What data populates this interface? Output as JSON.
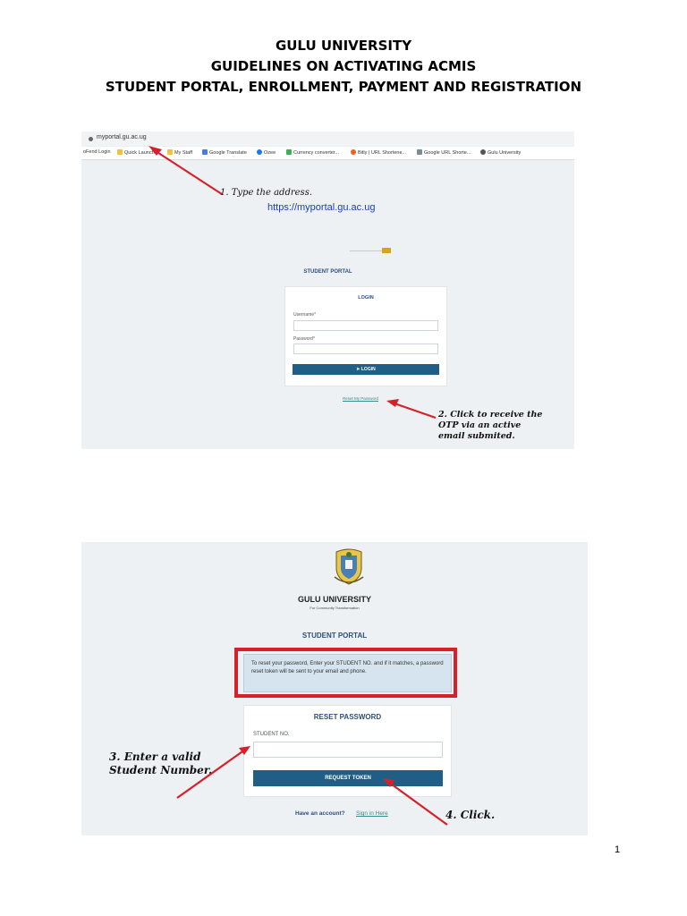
{
  "document": {
    "heading_line1": "GULU UNIVERSITY",
    "heading_line2": "GUIDELINES ON ACTIVATING ACMIS",
    "heading_line3": "STUDENT PORTAL, ENROLLMENT, PAYMENT AND REGISTRATION",
    "page_number": "1"
  },
  "screenshot1": {
    "address_bar": "myportal.gu.ac.ug",
    "bookmarks": [
      "oFend Login",
      "Quick Launch",
      "My Staff",
      "Google Translate",
      "Ozee",
      "Currency converter...",
      "Bitly | URL Shortene...",
      "Google URL Shorte...",
      "Gulu University"
    ],
    "annotation_step1": "1. Type the address.",
    "portal_url": "https://myportal.gu.ac.ug",
    "portal_title": "STUDENT PORTAL",
    "login_title": "LOGIN",
    "username_label": "Username*",
    "password_label": "Password*",
    "login_button": "LOGIN",
    "reset_link": "Reset My Password",
    "annotation_step2_line1": "2. Click to receive the",
    "annotation_step2_line2": "OTP via an active",
    "annotation_step2_line3": "email submited."
  },
  "screenshot2": {
    "university_name": "GULU UNIVERSITY",
    "motto": "For Community Transformation",
    "portal_title": "STUDENT PORTAL",
    "info_text": "To reset your password, Enter your STUDENT NO. and if it matches, a password reset token will be sent to your email and phone.",
    "reset_title": "RESET PASSWORD",
    "student_no_label": "STUDENT NO.",
    "request_button": "REQUEST TOKEN",
    "account_question": "Have an account?",
    "sign_in_link": "Sign in Here",
    "annotation_step3_line1": "3. Enter a valid",
    "annotation_step3_line2": "Student Number.",
    "annotation_step4": "4. Click."
  },
  "colors": {
    "primary_button": "#1f5f85",
    "portal_title": "#2c4f7c",
    "highlight_box": "#d6202a",
    "arrow": "#d6202a",
    "link": "#3b8a8a",
    "url_link": "#1a3fb8"
  }
}
